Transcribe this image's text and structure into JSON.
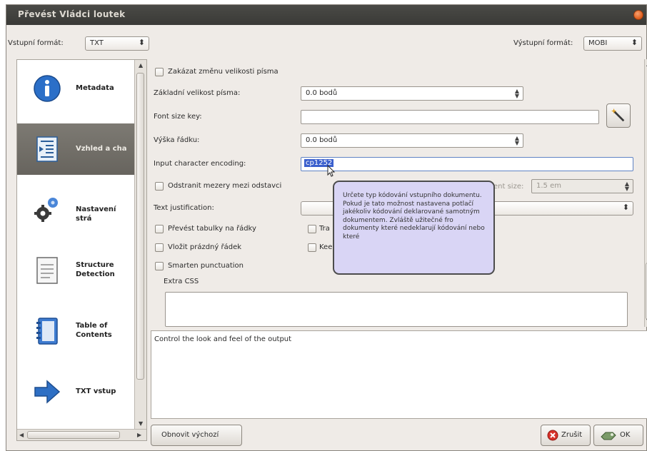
{
  "window": {
    "title": "Převést Vládci loutek"
  },
  "format_bar": {
    "input_label": "Vstupní formát:",
    "input_value": "TXT",
    "output_label": "Výstupní formát:",
    "output_value": "MOBI"
  },
  "sidebar": {
    "items": [
      {
        "label": "Metadata",
        "icon": "info-icon"
      },
      {
        "label": "Vzhled a chа",
        "icon": "layout-icon",
        "selected": true
      },
      {
        "label": "Nastavení strá",
        "icon": "gears-icon"
      },
      {
        "label": "Structure Detection",
        "icon": "document-icon"
      },
      {
        "label": "Table of Contents",
        "icon": "notebook-icon"
      },
      {
        "label": "TXT vstup",
        "icon": "arrow-right-icon"
      }
    ]
  },
  "form": {
    "disable_font_rescaling": "Zakázat změnu velikosti písma",
    "base_font_size_label": "Základní velikost písma:",
    "base_font_size_value": "0.0 bodů",
    "font_size_key_label": "Font size key:",
    "font_size_key_value": "",
    "line_height_label": "Výška řádku:",
    "line_height_value": "0.0 bodů",
    "input_encoding_label": "Input character encoding:",
    "input_encoding_value": "cp1252",
    "remove_spacing_label": "Odstranit mezery mezi odstavci",
    "indent_size_label": "ent size:",
    "indent_size_value": "1.5 em",
    "text_justification_label": "Text justification:",
    "text_justification_value": "",
    "tables_to_lines": "Převést tabulky na řádky",
    "tables_to_lines_right": "Tra",
    "insert_blank_line": "Vložit prázdný řádek",
    "insert_blank_line_right": "Kee",
    "smarten_punctuation": "Smarten punctuation",
    "extra_css_label": "Extra CSS",
    "extra_css_value": ""
  },
  "tooltip": {
    "text": "Určete typ kódování vstupního dokumentu. Pokud je tato možnost nastavena potlačí jakékoliv kódování deklarované samotným dokumentem. Zvláště užitečné fro dokumenty které nedeklarují kódování nebo které"
  },
  "description": {
    "text": "Control the look and feel of the output"
  },
  "buttons": {
    "restore_defaults": "Obnovit výchozí",
    "cancel": "Zrušit",
    "ok": "OK"
  },
  "colors": {
    "titlebar": "#3f3f3c",
    "tooltip_bg": "#d9d5f5",
    "selected_item": "#706d67",
    "selection_highlight": "#3a5fcd"
  }
}
